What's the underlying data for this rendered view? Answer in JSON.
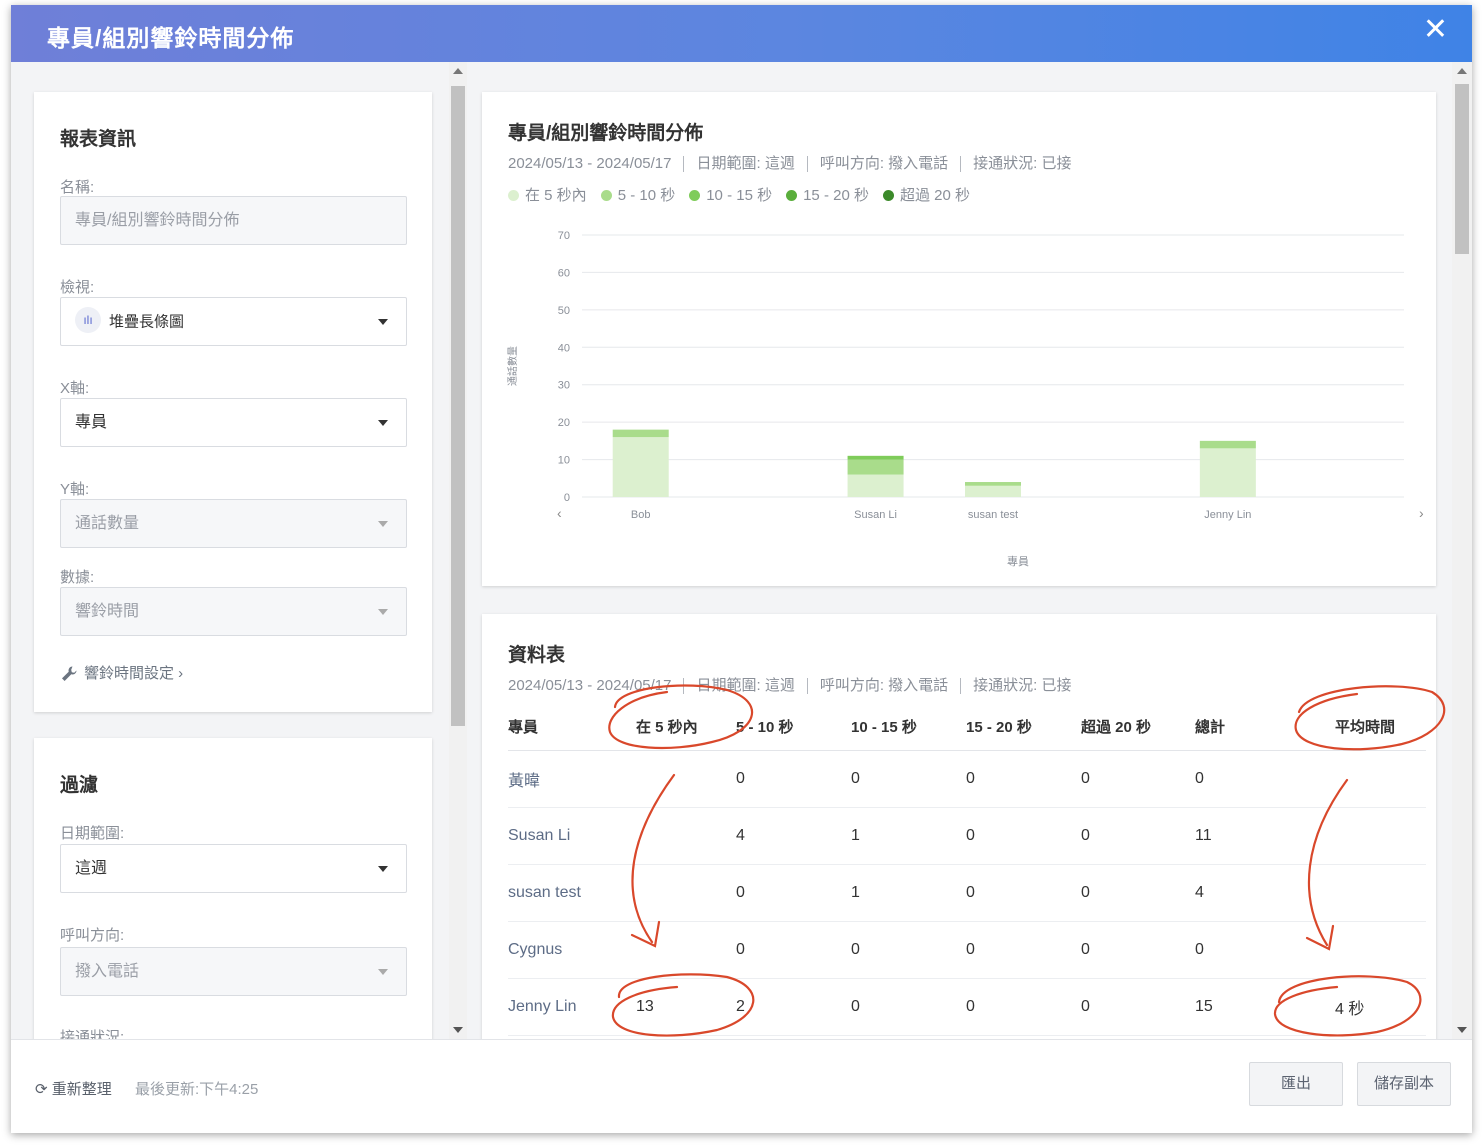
{
  "dialog": {
    "title": "專員/組別響鈴時間分佈",
    "close": "✕"
  },
  "report_info": {
    "heading": "報表資訊",
    "name_label": "名稱:",
    "name_value": "專員/組別響鈴時間分佈",
    "view_label": "檢視:",
    "view_value": "堆疊長條圖",
    "x_label": "X軸:",
    "x_value": "專員",
    "y_label": "Y軸:",
    "y_value": "通話數量",
    "data_label": "數據:",
    "data_value": "響鈴時間",
    "setting_link": "響鈴時間設定 ›"
  },
  "filter": {
    "heading": "過濾",
    "date_label": "日期範圍:",
    "date_value": "這週",
    "direction_label": "呼叫方向:",
    "direction_value": "撥入電話",
    "status_label": "接通狀況:"
  },
  "chart_card": {
    "title": "專員/組別響鈴時間分佈",
    "meta": [
      "2024/05/13 - 2024/05/17",
      "日期範圍: 這週",
      "呼叫方向: 撥入電話",
      "接通狀況: 已接"
    ]
  },
  "chart_data": {
    "type": "bar",
    "stacked": true,
    "categories": [
      "Bob",
      "Susan Li",
      "susan test",
      "Jenny Lin"
    ],
    "series": [
      {
        "name": "在 5 秒內",
        "color": "#dcf0cf",
        "values": [
          16,
          6,
          3,
          13
        ]
      },
      {
        "name": "5 - 10 秒",
        "color": "#a9dc8b",
        "values": [
          2,
          4,
          1,
          2
        ]
      },
      {
        "name": "10 - 15 秒",
        "color": "#7fcc5a",
        "values": [
          0,
          1,
          0,
          0
        ]
      },
      {
        "name": "15 - 20 秒",
        "color": "#5aae3c",
        "values": [
          0,
          0,
          0,
          0
        ]
      },
      {
        "name": "超過 20 秒",
        "color": "#3c8a2a",
        "values": [
          0,
          0,
          0,
          0
        ]
      }
    ],
    "ylabel": "通話數量",
    "xlabel": "專員",
    "ylim": [
      0,
      70
    ],
    "yticks": [
      "0",
      "10",
      "20",
      "30",
      "40",
      "50",
      "60",
      "70"
    ],
    "grid": true,
    "legend": "top-left"
  },
  "table_card": {
    "title": "資料表",
    "meta": [
      "2024/05/13 - 2024/05/17",
      "日期範圍: 這週",
      "呼叫方向: 撥入電話",
      "接通狀況: 已接"
    ],
    "columns": [
      "專員",
      "在 5 秒內",
      "5 - 10 秒",
      "10 - 15 秒",
      "15 - 20 秒",
      "超過 20 秒",
      "總計",
      "平均時間"
    ],
    "rows": [
      [
        "黃暐",
        "",
        "0",
        "0",
        "0",
        "0",
        "0",
        ""
      ],
      [
        "Susan Li",
        "",
        "4",
        "1",
        "0",
        "0",
        "11",
        ""
      ],
      [
        "susan test",
        "",
        "0",
        "1",
        "0",
        "0",
        "4",
        ""
      ],
      [
        "Cygnus",
        "",
        "0",
        "0",
        "0",
        "0",
        "0",
        ""
      ],
      [
        "Jenny Lin",
        "13",
        "2",
        "0",
        "0",
        "0",
        "15",
        "4 秒"
      ]
    ]
  },
  "footer": {
    "refresh": "重新整理",
    "last_update": "最後更新:下午4:25",
    "export": "匯出",
    "save_copy": "儲存副本"
  }
}
